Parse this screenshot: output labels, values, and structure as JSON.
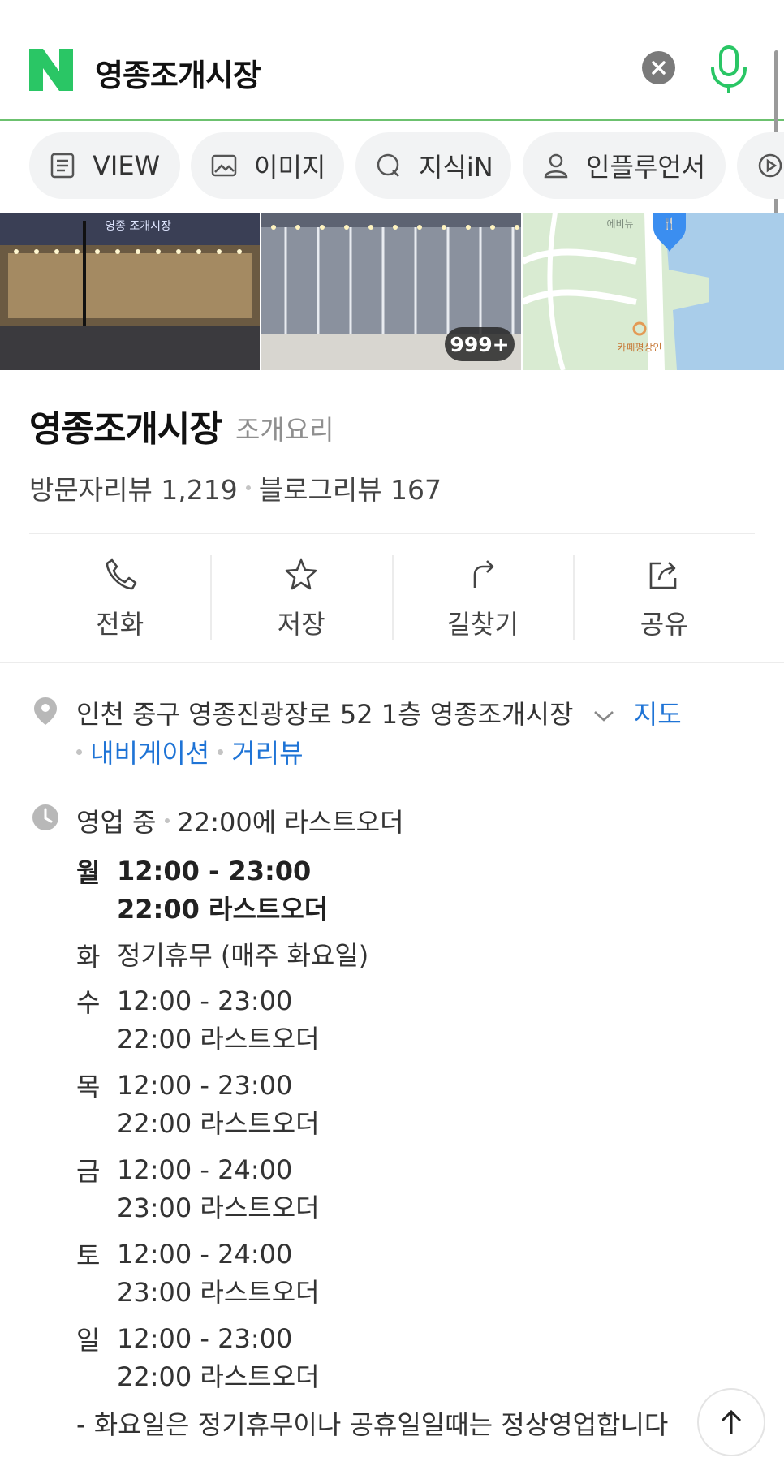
{
  "search": {
    "query": "영종조개시장"
  },
  "tabs": [
    {
      "label": "VIEW",
      "icon": "document-icon"
    },
    {
      "label": "이미지",
      "icon": "image-icon"
    },
    {
      "label": "지식iN",
      "icon": "q-icon"
    },
    {
      "label": "인플루언서",
      "icon": "person-icon"
    }
  ],
  "photos": {
    "count_badge": "999+"
  },
  "place": {
    "name": "영종조개시장",
    "category": "조개요리",
    "visitor_reviews": "방문자리뷰 1,219",
    "blog_reviews": "블로그리뷰 167"
  },
  "actions": [
    {
      "label": "전화",
      "icon": "phone-icon"
    },
    {
      "label": "저장",
      "icon": "star-icon"
    },
    {
      "label": "길찾기",
      "icon": "directions-icon"
    },
    {
      "label": "공유",
      "icon": "share-icon"
    }
  ],
  "info": {
    "address": "인천 중구 영종진광장로 52 1층 영종조개시장",
    "map_link": "지도",
    "navigation_link": "내비게이션",
    "street_view_link": "거리뷰",
    "open_status": "영업 중",
    "last_order": "22:00에 라스트오더"
  },
  "hours": [
    {
      "day": "월",
      "time": "12:00 - 23:00",
      "last": "22:00 라스트오더",
      "today": true
    },
    {
      "day": "화",
      "time": "정기휴무 (매주 화요일)",
      "last": ""
    },
    {
      "day": "수",
      "time": "12:00 - 23:00",
      "last": "22:00 라스트오더"
    },
    {
      "day": "목",
      "time": "12:00 - 23:00",
      "last": "22:00 라스트오더"
    },
    {
      "day": "금",
      "time": "12:00 - 24:00",
      "last": "23:00 라스트오더"
    },
    {
      "day": "토",
      "time": "12:00 - 24:00",
      "last": "23:00 라스트오더"
    },
    {
      "day": "일",
      "time": "12:00 - 23:00",
      "last": "22:00 라스트오더"
    }
  ],
  "hours_note": "- 화요일은 정기휴무이나 공휴일일때는 정상영업합니다",
  "colors": {
    "brand_green": "#03c75a",
    "link_blue": "#1f74d6"
  }
}
